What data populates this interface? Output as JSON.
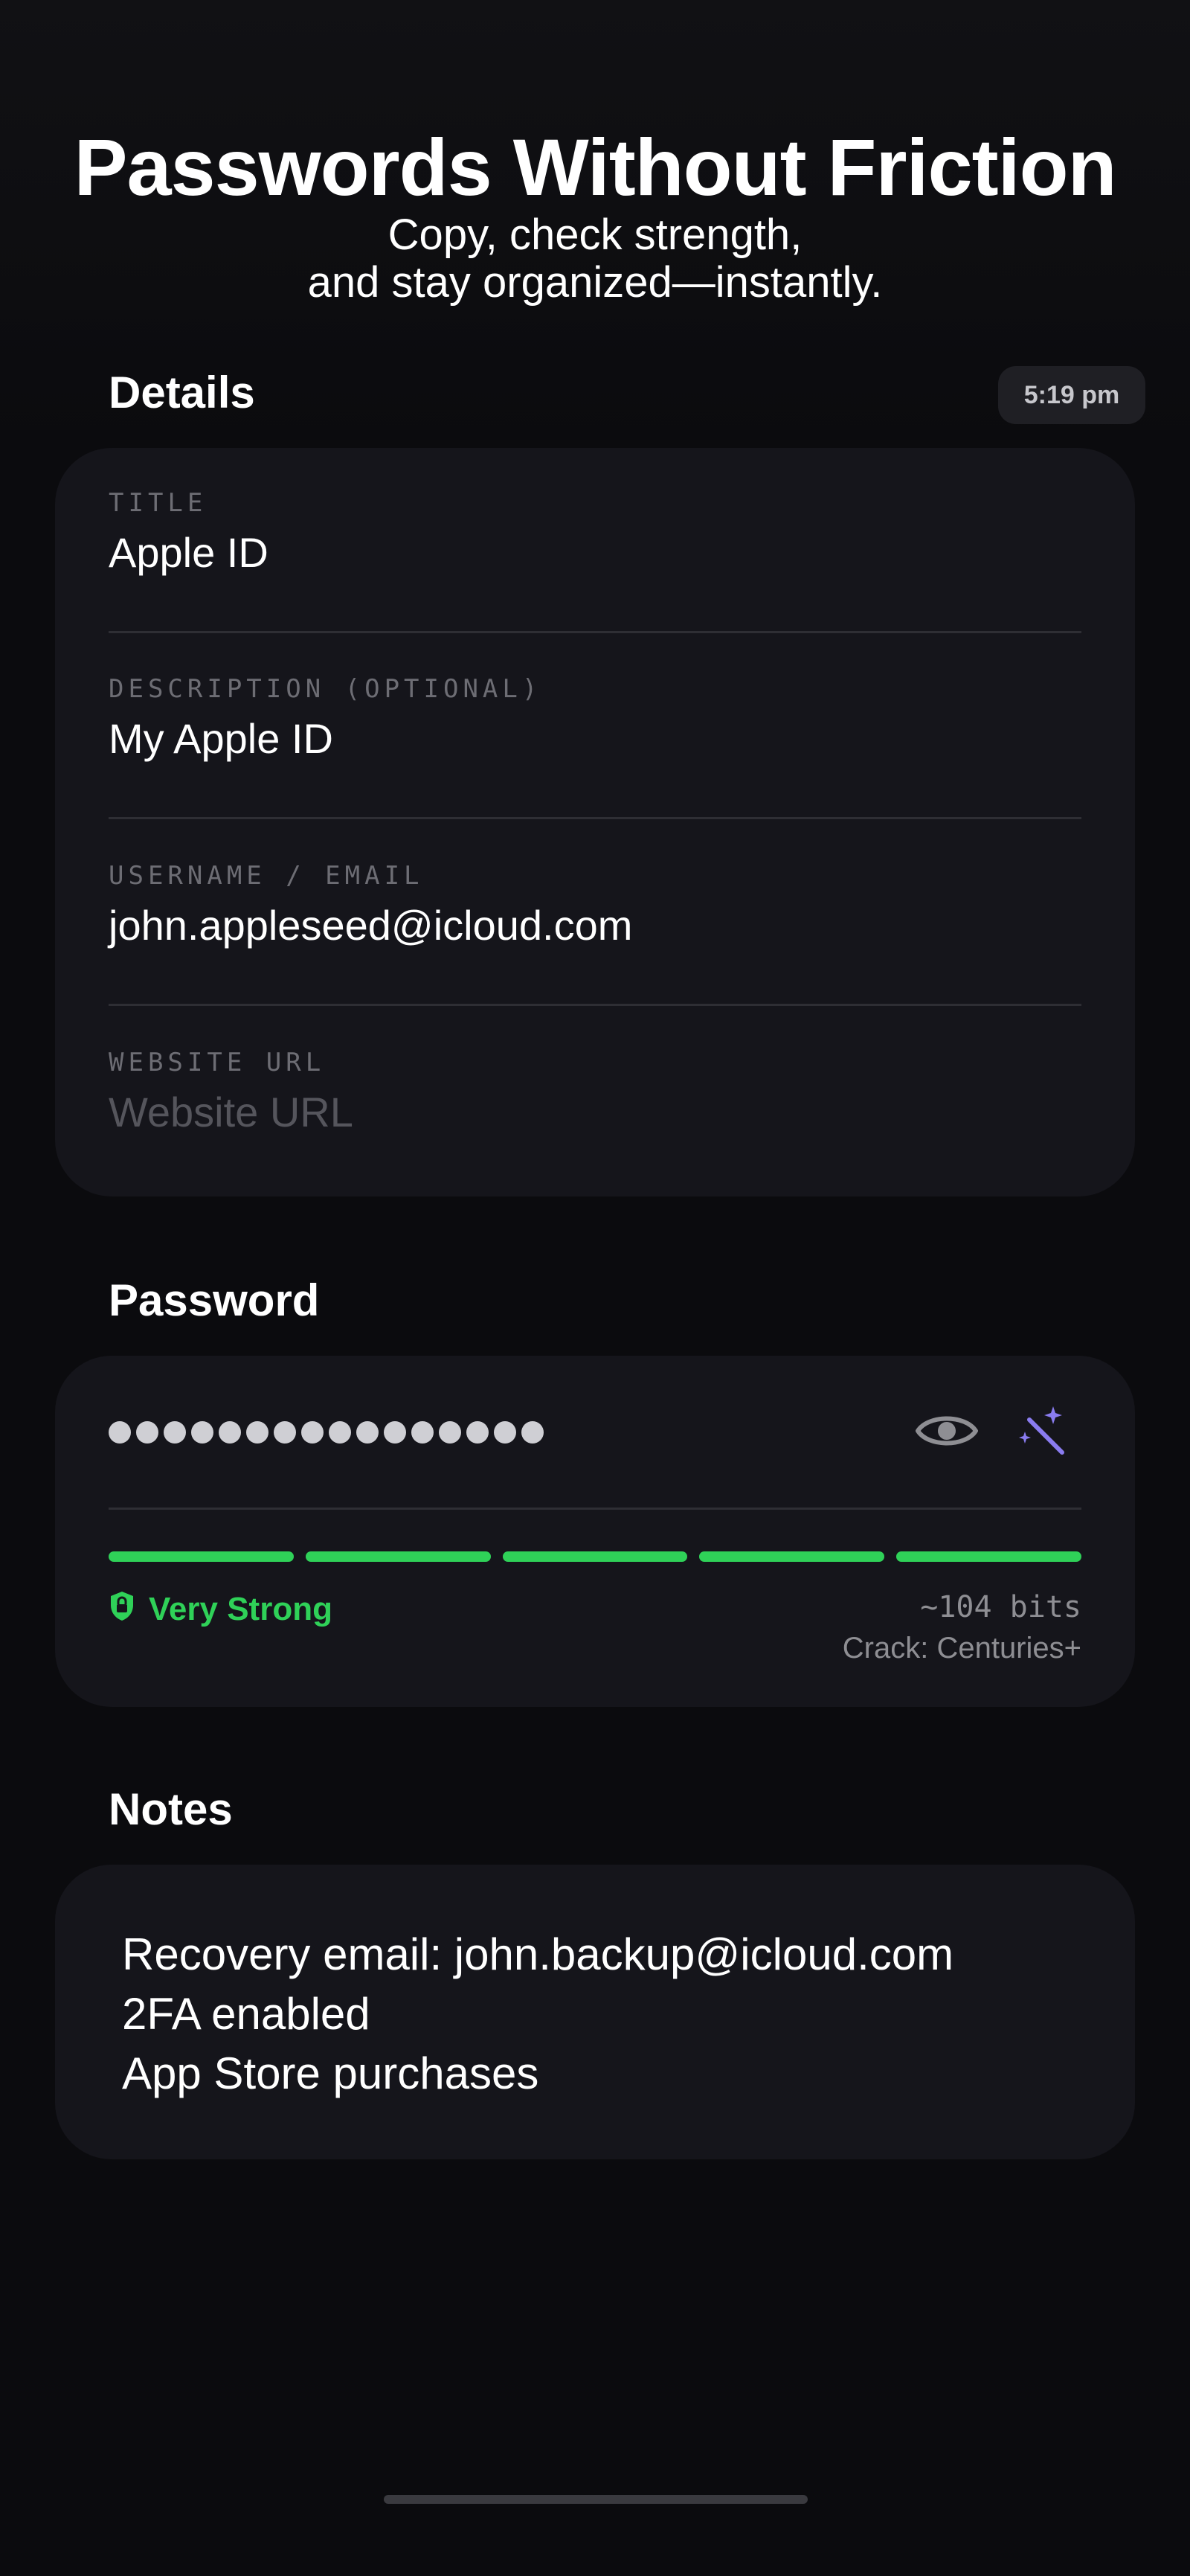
{
  "hero": {
    "title": "Passwords Without Friction",
    "subtitle_line1": "Copy, check strength,",
    "subtitle_line2": "and stay organized—instantly."
  },
  "details": {
    "section_title": "Details",
    "time": "5:19 pm",
    "fields": [
      {
        "label": "TITLE",
        "value": "Apple ID",
        "placeholder": ""
      },
      {
        "label": "DESCRIPTION (OPTIONAL)",
        "value": "My Apple ID",
        "placeholder": ""
      },
      {
        "label": "USERNAME / EMAIL",
        "value": "john.appleseed@icloud.com",
        "placeholder": ""
      },
      {
        "label": "WEBSITE URL",
        "value": "",
        "placeholder": "Website URL"
      }
    ]
  },
  "password": {
    "section_title": "Password",
    "masked_length": 16,
    "strength_segments_filled": 5,
    "strength_segments_total": 5,
    "strength_label": "Very Strong",
    "bits": "~104 bits",
    "crack_time": "Crack: Centuries+",
    "icons": [
      "eye-icon",
      "magic-wand-icon",
      "shield-lock-icon"
    ]
  },
  "notes": {
    "section_title": "Notes",
    "lines": [
      "Recovery email: john.backup@icloud.com",
      "2FA enabled",
      "App Store purchases"
    ]
  },
  "colors": {
    "background": "#0b0b0e",
    "card": "#15151b",
    "strength_green": "#2fd158",
    "wand_purple": "#8a7cf0",
    "muted_text": "#8e8e93"
  }
}
